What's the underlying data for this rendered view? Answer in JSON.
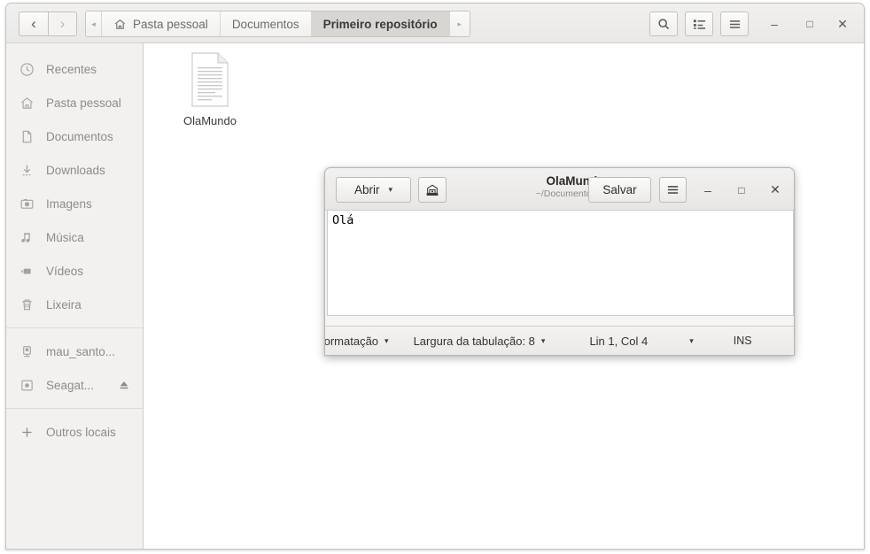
{
  "file_manager": {
    "nav": {
      "back_label": "‹",
      "forward_label": "›"
    },
    "breadcrumb": {
      "scroll_left": "◂",
      "scroll_right": "▸",
      "items": [
        {
          "label": "Pasta pessoal",
          "icon": "home-icon",
          "active": false
        },
        {
          "label": "Documentos",
          "icon": "",
          "active": false
        },
        {
          "label": "Primeiro repositório",
          "icon": "",
          "active": true
        }
      ]
    },
    "toolbar": {
      "search_icon": "search-icon",
      "view_icon": "list-view-icon",
      "menu_icon": "hamburger-menu-icon"
    },
    "window_controls": {
      "minimize": "–",
      "maximize": "□",
      "close": "✕"
    },
    "sidebar": {
      "items": [
        {
          "label": "Recentes",
          "icon": "clock-icon"
        },
        {
          "label": "Pasta pessoal",
          "icon": "home-icon"
        },
        {
          "label": "Documentos",
          "icon": "document-icon"
        },
        {
          "label": "Downloads",
          "icon": "download-arrow-icon"
        },
        {
          "label": "Imagens",
          "icon": "camera-icon"
        },
        {
          "label": "Música",
          "icon": "music-note-icon"
        },
        {
          "label": "Vídeos",
          "icon": "video-camera-icon"
        },
        {
          "label": "Lixeira",
          "icon": "trash-icon"
        }
      ],
      "devices": [
        {
          "label": "mau_santo...",
          "icon": "computer-icon",
          "eject": false
        },
        {
          "label": "Seagat...",
          "icon": "drive-icon",
          "eject": true,
          "eject_icon": "eject-icon"
        }
      ],
      "other": {
        "label": "Outros locais",
        "icon": "plus-icon"
      }
    },
    "files": [
      {
        "name": "OlaMundo",
        "icon": "text-document-icon"
      }
    ]
  },
  "gedit": {
    "open_button": {
      "label": "Abrir",
      "caret": "▾"
    },
    "saveas_icon": "save-as-icon",
    "title": "OlaMundo",
    "subtitle": "~/Documentos/Pr...",
    "save_button": {
      "label": "Salvar"
    },
    "menu_icon": "hamburger-menu-icon",
    "window_controls": {
      "minimize": "–",
      "maximize": "□",
      "close": "✕"
    },
    "document_text": "Olá",
    "statusbar": {
      "format_label": "formatação",
      "format_caret": "▾",
      "tab_width_label": "Largura da tabulação: 8",
      "tab_caret": "▾",
      "position_label": "Lin 1, Col 4",
      "position_caret": "▾",
      "insert_mode": "INS"
    }
  }
}
